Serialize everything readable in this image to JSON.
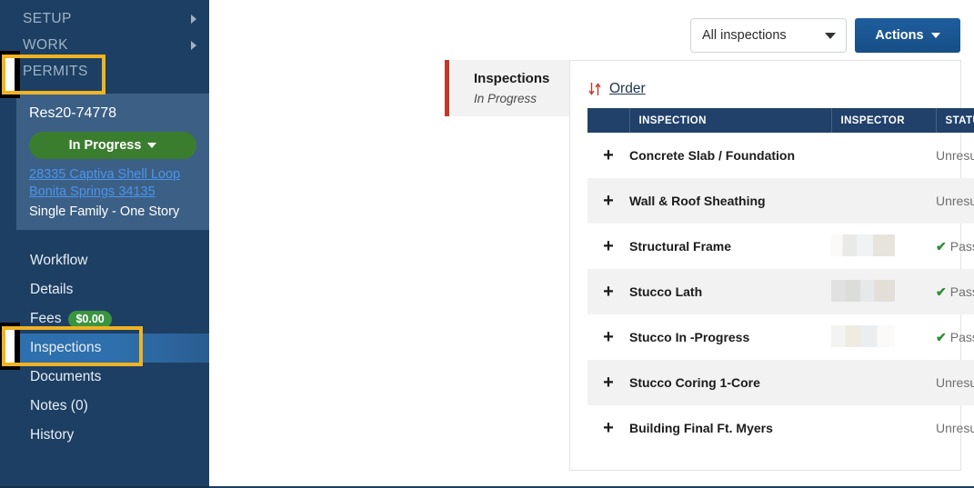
{
  "sidebar": {
    "groups": [
      {
        "label": "SETUP",
        "icon": "chevron-right-icon"
      },
      {
        "label": "WORK",
        "icon": "chevron-right-icon"
      },
      {
        "label": "PERMITS",
        "icon": ""
      }
    ],
    "permit_card": {
      "permit_id": "Res20-74778",
      "status_label": "In Progress",
      "status_color": "#3b7d2f",
      "address_line1": "28335 Captiva Shell Loop",
      "address_line2": "Bonita Springs 34135",
      "permit_type": "Single Family - One Story",
      "link_color": "#4b93ea"
    },
    "items": [
      {
        "label": "Workflow",
        "badge": "",
        "active": false
      },
      {
        "label": "Details",
        "badge": "",
        "active": false
      },
      {
        "label": "Fees",
        "badge": "$0.00",
        "active": false
      },
      {
        "label": "Inspections",
        "badge": "",
        "active": true
      },
      {
        "label": "Documents",
        "badge": "",
        "active": false
      },
      {
        "label": "Notes  (0)",
        "badge": "",
        "active": false
      },
      {
        "label": "History",
        "badge": "",
        "active": false
      }
    ]
  },
  "toolbar": {
    "filter_value": "All inspections",
    "actions_label": "Actions"
  },
  "tab_card": {
    "title": "Inspections",
    "subtitle": "In Progress",
    "accent_color": "#c0392b"
  },
  "panel": {
    "order_label": "Order",
    "order_icon": "sort-arrows-icon",
    "columns": [
      "",
      "INSPECTION",
      "INSPECTOR",
      "STATUS",
      "",
      ""
    ],
    "rows": [
      {
        "expand": "+",
        "inspection": "Concrete Slab / Foundation",
        "inspector": "",
        "inspector_redacted": false,
        "status": "Unresulted",
        "passed": false,
        "edit_icon": "pencil-icon",
        "delete_icon": "trash-icon",
        "delete_enabled": true
      },
      {
        "expand": "+",
        "inspection": "Wall & Roof Sheathing",
        "inspector": "",
        "inspector_redacted": false,
        "status": "Unresulted",
        "passed": false,
        "edit_icon": "pencil-icon",
        "delete_icon": "trash-icon",
        "delete_enabled": true
      },
      {
        "expand": "+",
        "inspection": "Structural Frame",
        "inspector": "",
        "inspector_redacted": true,
        "status": "Passed",
        "passed": true,
        "edit_icon": "pencil-icon",
        "delete_icon": "trash-icon",
        "delete_enabled": false
      },
      {
        "expand": "+",
        "inspection": "Stucco Lath",
        "inspector": "",
        "inspector_redacted": true,
        "status": "Passed",
        "passed": true,
        "edit_icon": "pencil-icon",
        "delete_icon": "trash-icon",
        "delete_enabled": false
      },
      {
        "expand": "+",
        "inspection": "Stucco In -Progress",
        "inspector": "",
        "inspector_redacted": true,
        "status": "Passed",
        "passed": true,
        "edit_icon": "pencil-icon",
        "delete_icon": "trash-icon",
        "delete_enabled": false
      },
      {
        "expand": "+",
        "inspection": "Stucco Coring 1-Core",
        "inspector": "",
        "inspector_redacted": false,
        "status": "Unresulted",
        "passed": false,
        "edit_icon": "pencil-icon",
        "delete_icon": "trash-icon",
        "delete_enabled": true
      },
      {
        "expand": "+",
        "inspection": "Building Final Ft. Myers",
        "inspector": "",
        "inspector_redacted": false,
        "status": "Unresulted",
        "passed": false,
        "edit_icon": "pencil-icon",
        "delete_icon": "trash-icon",
        "delete_enabled": true
      }
    ]
  },
  "annotations": {
    "highlight_color": "#f0b323",
    "boxes": [
      "PERMITS",
      "Inspections"
    ]
  },
  "colors": {
    "nav_bg": "#1d3f63",
    "card_bg": "#3c6085",
    "table_header": "#21416a",
    "accent_red": "#c0392b",
    "passed_green": "#2f8c32"
  }
}
